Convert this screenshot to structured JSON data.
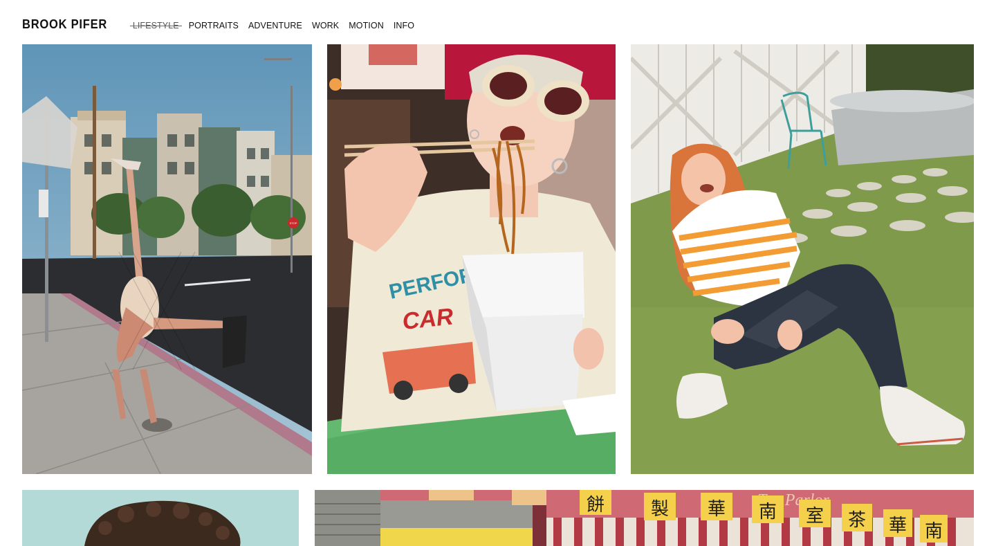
{
  "site": {
    "title": "BROOK PIFER"
  },
  "nav": {
    "items": [
      {
        "label": "LIFESTYLE",
        "active": true
      },
      {
        "label": "PORTRAITS",
        "active": false
      },
      {
        "label": "ADVENTURE",
        "active": false
      },
      {
        "label": "WORK",
        "active": false
      },
      {
        "label": "MOTION",
        "active": false
      },
      {
        "label": "INFO",
        "active": false
      }
    ]
  },
  "gallery": {
    "photos": [
      {
        "subject": "handstand-on-sidewalk"
      },
      {
        "subject": "eating-noodles-sunglasses"
      },
      {
        "subject": "laughing-on-grass-striped-shirt"
      },
      {
        "subject": "curly-hair-portrait"
      },
      {
        "subject": "tea-parlor-storefront"
      }
    ],
    "shirt_text_1": "PERFORM",
    "shirt_text_2": "CAR",
    "stop_sign_text": "STOP",
    "storefront_text": "Tea Parlor",
    "storefront_chars": [
      "餅",
      "製",
      "華",
      "南",
      "室",
      "茶",
      "華",
      "南"
    ]
  }
}
